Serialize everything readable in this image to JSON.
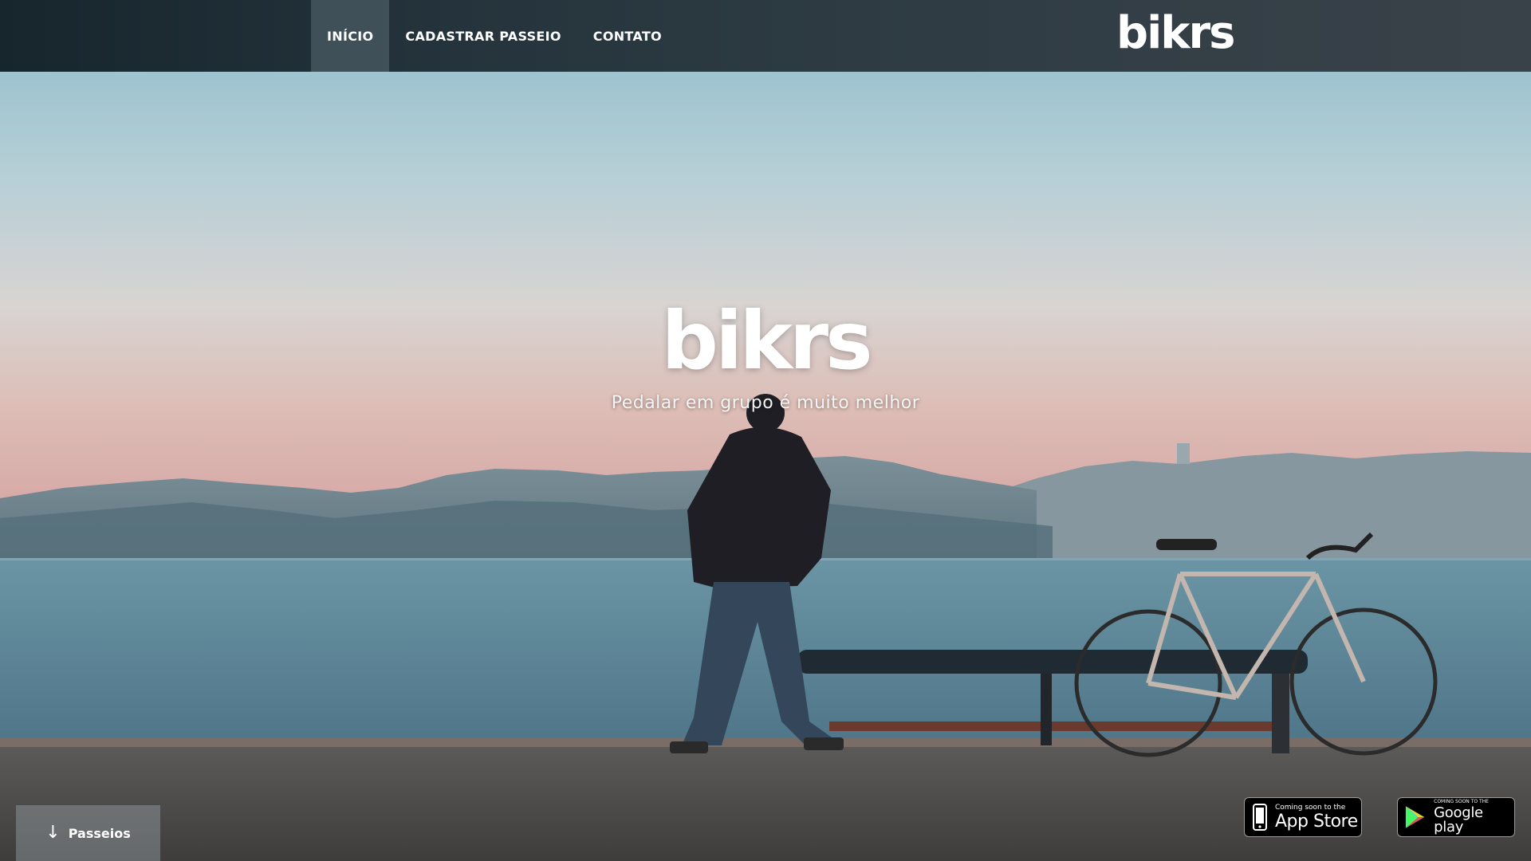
{
  "nav": {
    "items": [
      {
        "label": "INÍCIO",
        "active": true
      },
      {
        "label": "CADASTRAR PASSEIO",
        "active": false
      },
      {
        "label": "CONTATO",
        "active": false
      }
    ],
    "brand": "bikrs"
  },
  "hero": {
    "title": "bikrs",
    "tagline": "Pedalar em grupo é muito melhor"
  },
  "scroll_button": {
    "label": "Passeios",
    "icon": "arrow-down-icon"
  },
  "badges": {
    "appstore": {
      "small": "Coming soon to the",
      "big": "App Store",
      "icon": "phone-icon"
    },
    "google": {
      "small": "COMING SOON TO THE",
      "big": "Google play",
      "icon": "play-triangle-icon"
    }
  },
  "colors": {
    "nav_bg": "#25343c",
    "text": "#ffffff",
    "sky_top": "#8fbccb",
    "sky_horizon": "#d9b5b2",
    "water": "#5d8a9c"
  }
}
